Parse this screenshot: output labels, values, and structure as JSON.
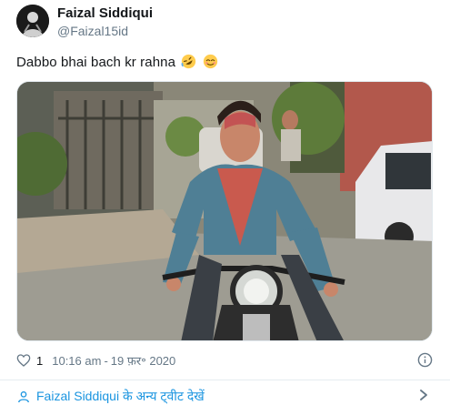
{
  "author": {
    "name": "Faizal Siddiqui",
    "handle": "@Faizal15id"
  },
  "tweet": {
    "text": "Dabbo bhai bach kr rahna",
    "emojis": [
      "rolling-on-floor-laughing-emoji",
      "relieved-face-emoji"
    ]
  },
  "media": {
    "description_icon": "photo"
  },
  "meta": {
    "like_icon": "heart-icon",
    "like_count": "1",
    "time": "10:16 am",
    "separator": "-",
    "date": "19 फ़र॰ 2020",
    "info_icon": "info-icon"
  },
  "footer": {
    "link_label": "Faizal Siddiqui के अन्य ट्वीट देखें",
    "icon": "profile-icon",
    "chevron": "chevron-right-icon"
  },
  "colors": {
    "link": "#1b95e0",
    "secondary_text": "#657786",
    "primary_text": "#14171a"
  }
}
